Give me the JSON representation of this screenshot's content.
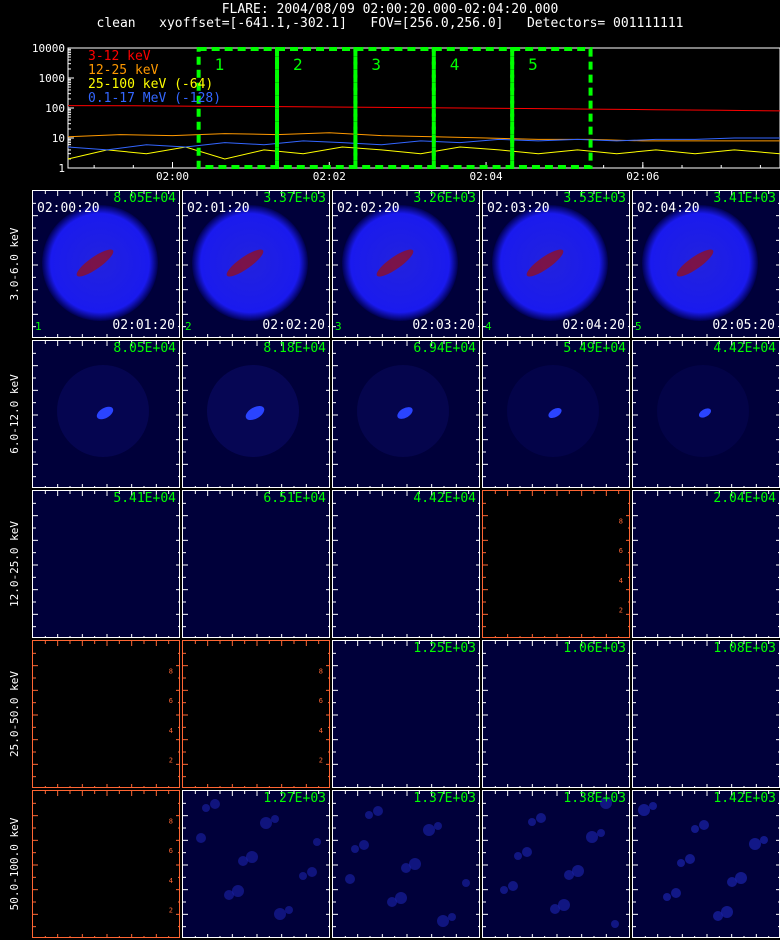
{
  "header": {
    "line1": "FLARE: 2004/08/09 02:00:20.000-02:04:20.000",
    "line2": "clean   xyoffset=[-641.1,-302.1]   FOV=[256.0,256.0]   Detectors= 001111111"
  },
  "colors": {
    "red": "#ff0000",
    "orange": "#ff9900",
    "yellow": "#ffff00",
    "blue": "#3366ff",
    "green": "#00ff00",
    "panel_bg": "#00003a",
    "blank_axis": "#ff6633"
  },
  "chart_data": [
    {
      "type": "line",
      "yscale": "log",
      "ylim": [
        1,
        10000
      ],
      "xlim": [
        "01:58:40",
        "02:07:45"
      ],
      "yticks": [
        "1",
        "10",
        "100",
        "1000",
        "10000"
      ],
      "xticks": [
        "02:00",
        "02:02",
        "02:04",
        "02:06"
      ],
      "series": [
        {
          "name": "3-12 keV",
          "color": "#ff0000",
          "x": [
            "01:58:40",
            "01:59:30",
            "02:00:20",
            "02:01:10",
            "02:02:00",
            "02:02:50",
            "02:03:40",
            "02:04:30",
            "02:05:20",
            "02:06:10",
            "02:07:00",
            "02:07:45"
          ],
          "y": [
            120,
            118,
            115,
            112,
            108,
            104,
            100,
            96,
            92,
            88,
            84,
            80
          ]
        },
        {
          "name": "12-25 keV",
          "color": "#ff9900",
          "x": [
            "01:58:40",
            "01:59:20",
            "02:00:00",
            "02:00:40",
            "02:01:20",
            "02:02:00",
            "02:02:40",
            "02:03:20",
            "02:04:00",
            "02:04:40",
            "02:05:20",
            "02:06:00",
            "02:06:40",
            "02:07:20",
            "02:07:45"
          ],
          "y": [
            11,
            13,
            12,
            14,
            13,
            15,
            12,
            11,
            10,
            9,
            9,
            8,
            8,
            8,
            8
          ]
        },
        {
          "name": "25-100 keV (-64)",
          "color": "#ffff00",
          "x": [
            "01:58:40",
            "01:59:10",
            "01:59:40",
            "02:00:10",
            "02:00:40",
            "02:01:10",
            "02:01:40",
            "02:02:10",
            "02:02:40",
            "02:03:10",
            "02:03:40",
            "02:04:10",
            "02:04:40",
            "02:05:10",
            "02:05:40",
            "02:06:10",
            "02:06:40",
            "02:07:10",
            "02:07:45"
          ],
          "y": [
            2,
            4,
            3,
            5,
            2,
            4,
            3,
            5,
            4,
            3,
            5,
            4,
            3,
            4,
            3,
            4,
            3,
            4,
            3
          ]
        },
        {
          "name": "0.1-17 MeV (-128)",
          "color": "#3366ff",
          "x": [
            "01:58:40",
            "01:59:10",
            "01:59:40",
            "02:00:10",
            "02:00:40",
            "02:01:10",
            "02:01:40",
            "02:02:10",
            "02:02:40",
            "02:03:10",
            "02:03:40",
            "02:04:10",
            "02:04:40",
            "02:05:10",
            "02:05:40",
            "02:06:10",
            "02:06:40",
            "02:07:10",
            "02:07:45"
          ],
          "y": [
            5,
            4,
            6,
            5,
            7,
            6,
            8,
            7,
            6,
            8,
            7,
            9,
            8,
            9,
            8,
            9,
            9,
            10,
            10
          ]
        }
      ],
      "intervals": [
        {
          "label": "1",
          "start": "02:00:20",
          "end": "02:01:20"
        },
        {
          "label": "2",
          "start": "02:01:20",
          "end": "02:02:20"
        },
        {
          "label": "3",
          "start": "02:02:20",
          "end": "02:03:20"
        },
        {
          "label": "4",
          "start": "02:03:20",
          "end": "02:04:20"
        },
        {
          "label": "5",
          "start": "02:04:20",
          "end": "02:05:20"
        }
      ]
    },
    {
      "type": "heatmap",
      "columns": [
        "1",
        "2",
        "3",
        "4",
        "5"
      ],
      "start_times": [
        "02:00:20",
        "02:01:20",
        "02:02:20",
        "02:03:20",
        "02:04:20"
      ],
      "end_times": [
        "02:01:20",
        "02:02:20",
        "02:03:20",
        "02:04:20",
        "02:05:20"
      ],
      "rows": [
        {
          "energy": "3.0-6.0 keV",
          "peaks": [
            "8.05E+04",
            "3.37E+03",
            "3.26E+03",
            "3.53E+03",
            "3.41E+03"
          ],
          "intensity": [
            1,
            1,
            1,
            1,
            1
          ]
        },
        {
          "energy": "6.0-12.0 keV",
          "peaks": [
            "8.05E+04",
            "8.18E+04",
            "6.94E+04",
            "5.49E+04",
            "4.42E+04"
          ],
          "intensity": [
            0.5,
            0.6,
            0.45,
            0.35,
            0.3
          ]
        },
        {
          "energy": "12.0-25.0 keV",
          "peaks": [
            "5.41E+04",
            "6.51E+04",
            "4.42E+04",
            "",
            "2.04E+04"
          ],
          "intensity": [
            0,
            0,
            0,
            null,
            0
          ]
        },
        {
          "energy": "25.0-50.0 keV",
          "peaks": [
            "",
            "",
            "1.25E+03",
            "1.06E+03",
            "1.08E+03"
          ],
          "intensity": [
            null,
            null,
            0,
            0,
            0
          ]
        },
        {
          "energy": "50.0-100.0 keV",
          "peaks": [
            "",
            "1.27E+03",
            "1.37E+03",
            "1.38E+03",
            "1.42E+03"
          ],
          "intensity": [
            null,
            0.1,
            0.12,
            0.14,
            0.2
          ]
        }
      ],
      "blank_ticks": [
        "2",
        "4",
        "6",
        "8"
      ]
    }
  ]
}
